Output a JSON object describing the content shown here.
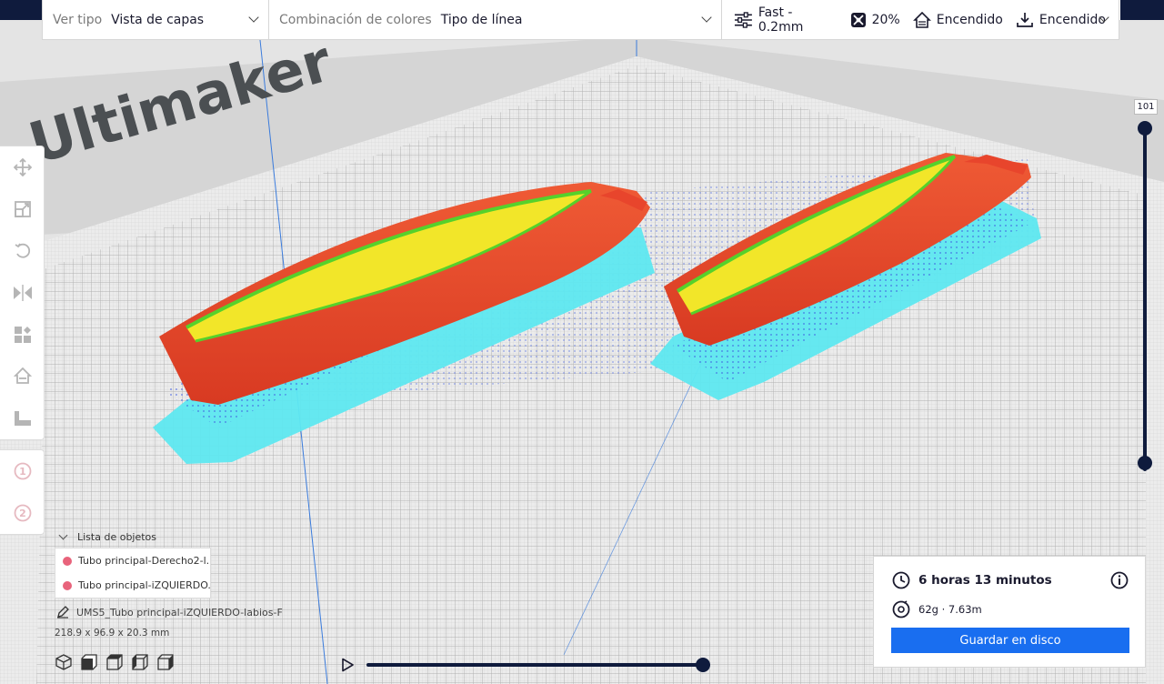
{
  "topbar": {
    "view_type_label": "Ver tipo",
    "view_type_value": "Vista de capas",
    "color_scheme_label": "Combinación de colores",
    "color_scheme_value": "Tipo de línea",
    "profile": "Fast - 0.2mm",
    "infill": "20%",
    "support": "Encendido",
    "adhesion": "Encendido"
  },
  "scene": {
    "build_plate_logo": "Ultimaker"
  },
  "tools": [
    "move-icon",
    "scale-icon",
    "rotate-icon",
    "mirror-icon",
    "per-model-settings-icon",
    "support-blocker-icon",
    "lay-flat-icon"
  ],
  "extruders": [
    "1",
    "2"
  ],
  "object_list": {
    "header": "Lista de objetos",
    "items": [
      {
        "name": "Tubo principal-Derecho2-l..."
      },
      {
        "name": "Tubo principal-iZQUIERDO..."
      }
    ],
    "file": "UMS5_Tubo principal-iZQUIERDO-labios-F",
    "dimensions": "218.9 x 96.9 x 20.3 mm"
  },
  "layer_slider": {
    "current_layer": "101",
    "max_fraction": 1.0,
    "min_fraction": 0.0
  },
  "playback": {
    "position_fraction": 1.0
  },
  "print_info": {
    "time": "6 horas 13 minutos",
    "material": "62g · 7.63m",
    "save_button": "Guardar en disco"
  },
  "colors": {
    "accent": "#196ef0",
    "dark": "#0f1b3d",
    "object_dot": "#e8637b",
    "wall": "#e8452c",
    "skin": "#f2e629",
    "inner_wall": "#56d12b",
    "support": "#5ee8f0",
    "travel": "#3d5be0"
  }
}
